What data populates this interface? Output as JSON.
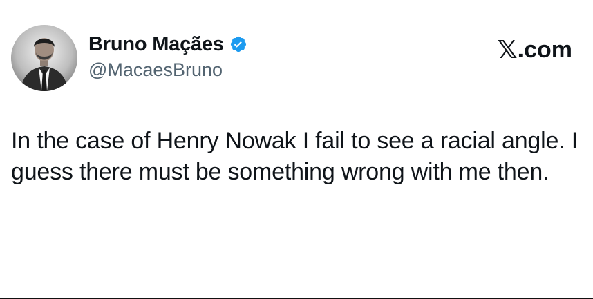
{
  "tweet": {
    "author": {
      "display_name": "Bruno Maçães",
      "handle": "@MacaesBruno",
      "verified": true,
      "verified_badge_color": "#1d9bf0",
      "avatar_icon": "profile-photo"
    },
    "brand": {
      "x_glyph": "𝕏",
      "suffix": ".com"
    },
    "text": "In the case of Henry Nowak I fail to see a racial angle. I guess there must be something wrong with me then."
  }
}
